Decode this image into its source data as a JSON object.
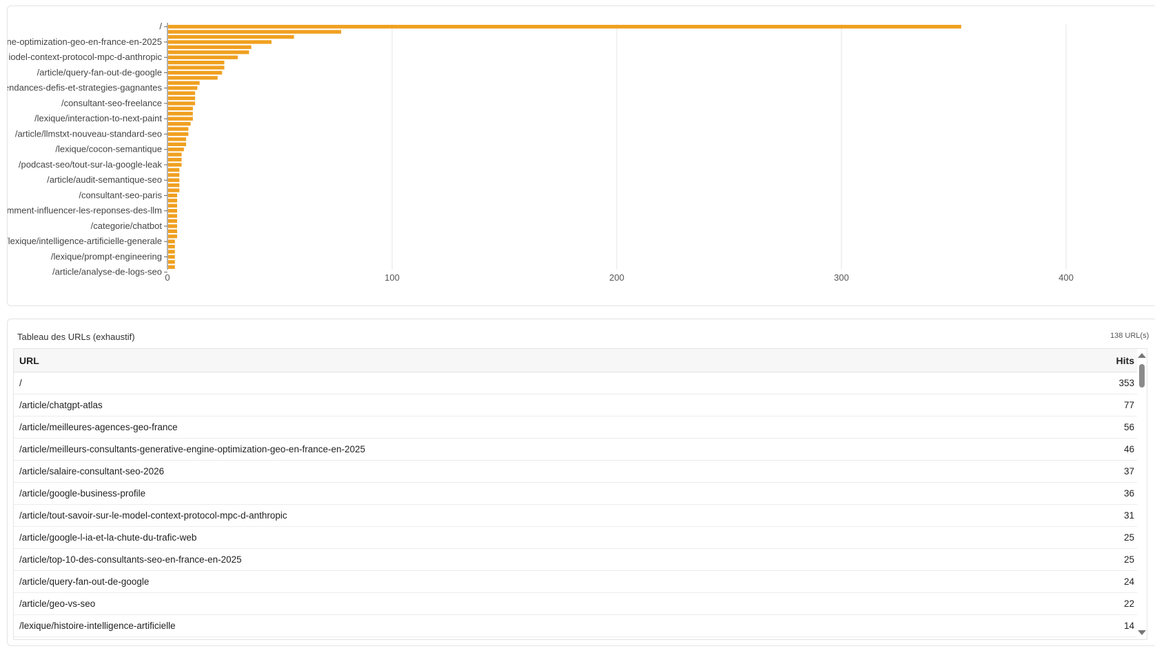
{
  "chart_data": {
    "type": "bar",
    "orientation": "horizontal",
    "color": "#f0a020",
    "grid": true,
    "xlim": [
      0,
      400
    ],
    "x_ticks": [
      "0",
      "100",
      "200",
      "300",
      "400"
    ],
    "labeled_categories": [
      "/",
      "ne-optimization-geo-en-france-en-2025",
      "iodel-context-protocol-mpc-d-anthropic",
      "/article/query-fan-out-de-google",
      "tendances-defis-et-strategies-gagnantes",
      "/consultant-seo-freelance",
      "/lexique/interaction-to-next-paint",
      "/article/llmstxt-nouveau-standard-seo",
      "/lexique/cocon-semantique",
      "/podcast-seo/tout-sur-la-google-leak",
      "/article/audit-semantique-seo",
      "/consultant-seo-paris",
      "omment-influencer-les-reponses-des-llm",
      "/categorie/chatbot",
      "/lexique/intelligence-artificielle-generale",
      "/lexique/prompt-engineering",
      "/article/analyse-de-logs-seo"
    ],
    "values": [
      353,
      77,
      56,
      46,
      37,
      36,
      31,
      25,
      25,
      24,
      22,
      14,
      13,
      12,
      12,
      12,
      11,
      11,
      11,
      10,
      9,
      9,
      8,
      8,
      7,
      6,
      6,
      6,
      5,
      5,
      5,
      5,
      5,
      4,
      4,
      4,
      4,
      4,
      4,
      4,
      4,
      4,
      3,
      3,
      3,
      3,
      3,
      3
    ]
  },
  "table": {
    "caption": "Tableau des URLs (exhaustif)",
    "count": "138 URL(s)",
    "col_url": "URL",
    "col_hits": "Hits",
    "rows": [
      {
        "url": "/",
        "hits": "353"
      },
      {
        "url": "/article/chatgpt-atlas",
        "hits": "77"
      },
      {
        "url": "/article/meilleures-agences-geo-france",
        "hits": "56"
      },
      {
        "url": "/article/meilleurs-consultants-generative-engine-optimization-geo-en-france-en-2025",
        "hits": "46"
      },
      {
        "url": "/article/salaire-consultant-seo-2026",
        "hits": "37"
      },
      {
        "url": "/article/google-business-profile",
        "hits": "36"
      },
      {
        "url": "/article/tout-savoir-sur-le-model-context-protocol-mpc-d-anthropic",
        "hits": "31"
      },
      {
        "url": "/article/google-l-ia-et-la-chute-du-trafic-web",
        "hits": "25"
      },
      {
        "url": "/article/top-10-des-consultants-seo-en-france-en-2025",
        "hits": "25"
      },
      {
        "url": "/article/query-fan-out-de-google",
        "hits": "24"
      },
      {
        "url": "/article/geo-vs-seo",
        "hits": "22"
      },
      {
        "url": "/lexique/histoire-intelligence-artificielle",
        "hits": "14"
      }
    ]
  }
}
